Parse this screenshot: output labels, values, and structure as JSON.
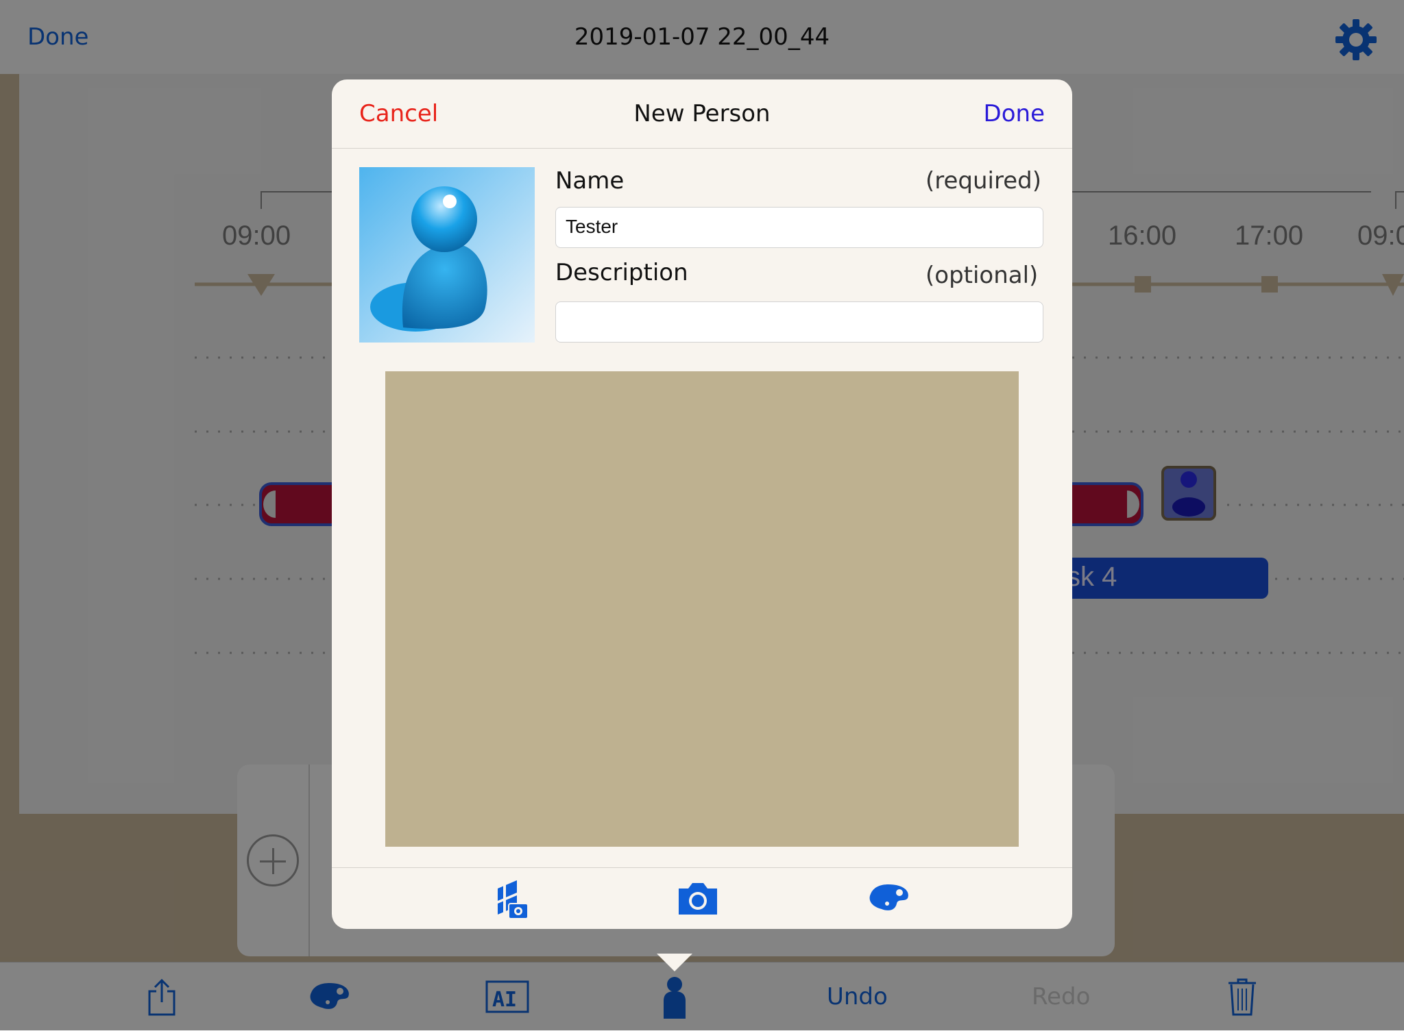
{
  "navbar": {
    "done_label": "Done",
    "title": "2019-01-07 22_00_44",
    "settings_icon": "gear-icon"
  },
  "timeline": {
    "ticks": [
      {
        "label": "09:00"
      },
      {
        "label": "16:00"
      },
      {
        "label": "17:00"
      },
      {
        "label": "09:0"
      }
    ],
    "task_label": "sk 4"
  },
  "toolbar": {
    "share_icon": "share-icon",
    "palette_icon": "palette-icon",
    "text_icon": "text-box-icon",
    "person_icon": "person-icon",
    "undo_label": "Undo",
    "redo_label": "Redo",
    "trash_icon": "trash-icon"
  },
  "modal": {
    "cancel_label": "Cancel",
    "title": "New Person",
    "done_label": "Done",
    "name_label": "Name",
    "name_hint": "(required)",
    "name_value": "Tester",
    "description_label": "Description",
    "description_hint": "(optional)",
    "description_value": "",
    "footer_icons": [
      "photo-library-icon",
      "camera-icon",
      "palette-icon"
    ]
  },
  "colors": {
    "accent_blue": "#1060d8",
    "cancel_red": "#e8231a",
    "modal_done_blue": "#2a1ad8",
    "task_red": "#b8123a",
    "task_blue": "#1a4fd8",
    "canvas_tan": "#beb190"
  }
}
